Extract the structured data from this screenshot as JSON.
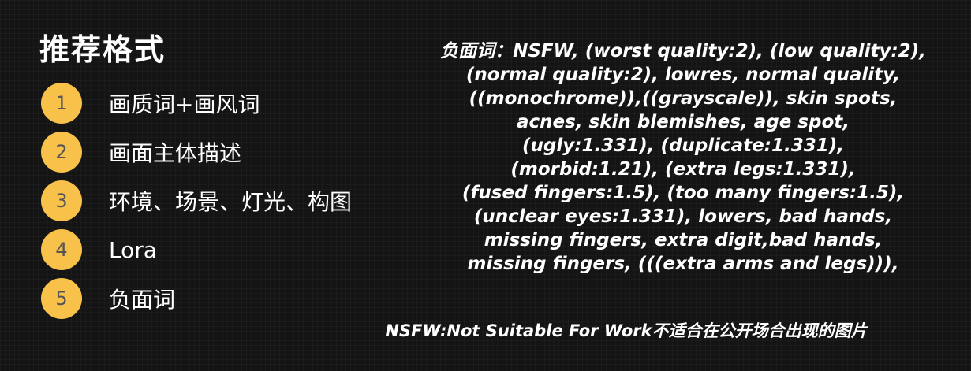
{
  "title": "推荐格式",
  "steps": [
    {
      "number": "1",
      "label": "画质词+画风词"
    },
    {
      "number": "2",
      "label": "画面主体描述"
    },
    {
      "number": "3",
      "label": "环境、场景、灯光、构图"
    },
    {
      "number": "4",
      "label": "Lora"
    },
    {
      "number": "5",
      "label": "负面词"
    }
  ],
  "negative_prompt_lines": [
    "负面词：NSFW, (worst quality:2), (low quality:2),",
    "(normal quality:2), lowres, normal quality,",
    "((monochrome)),((grayscale)), skin spots,",
    "acnes, skin blemishes, age spot,",
    "(ugly:1.331), (duplicate:1.331),",
    "(morbid:1.21), (extra legs:1.331),",
    "(fused fingers:1.5), (too many fingers:1.5),",
    "(unclear eyes:1.331), lowers, bad hands,",
    "missing fingers, extra digit,bad hands,",
    "missing fingers, (((extra arms and legs))),"
  ],
  "footnote": "NSFW:Not Suitable For Work不适合在公开场合出现的图片",
  "colors": {
    "background": "#141414",
    "badge": "#f7c14a",
    "badge_text": "#555555",
    "text": "#ffffff"
  }
}
